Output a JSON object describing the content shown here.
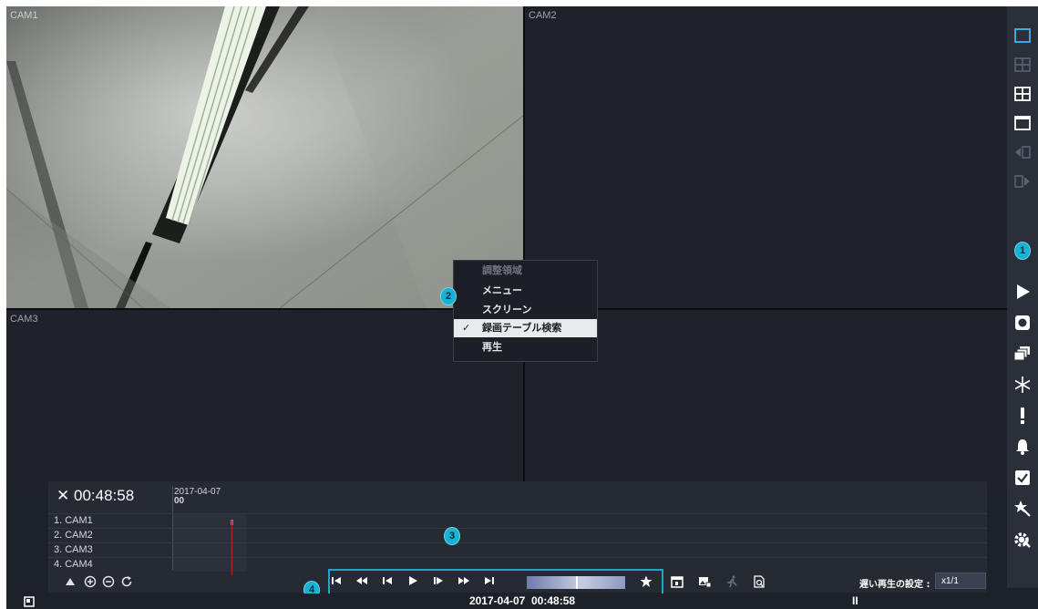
{
  "cameras": [
    {
      "label": "CAM1"
    },
    {
      "label": "CAM2"
    },
    {
      "label": "CAM3"
    }
  ],
  "context_menu": {
    "title": "調整領域",
    "items": [
      {
        "label": "メニュー",
        "checked": false
      },
      {
        "label": "スクリーン",
        "checked": false
      },
      {
        "label": "録画テーブル検索",
        "checked": true
      },
      {
        "label": "再生",
        "checked": false
      }
    ],
    "check_glyph": "✓"
  },
  "badges": [
    "1",
    "2",
    "3",
    "4"
  ],
  "timeline": {
    "current_time": "00:48:58",
    "date": "2017-04-07",
    "hour": "00",
    "channels": [
      "1. CAM1",
      "2. CAM2",
      "3. CAM3",
      "4. CAM4"
    ]
  },
  "playback": {
    "speed_label": "遅い再生の設定 :",
    "speed_value": "x1/1"
  },
  "status_bar": {
    "datetime": "2017-04-07  00:48:58",
    "pause_glyph": "II"
  },
  "sidebar_icons": [
    "single-view-icon",
    "quad-view-grey-icon",
    "quad-view-icon",
    "full-view-icon",
    "prev-icon",
    "next-icon",
    "play-icon",
    "record-icon",
    "sequence-icon",
    "freeze-icon",
    "alarm-icon",
    "bell-icon",
    "check-icon",
    "wizard-icon",
    "settings-icon"
  ],
  "colors": {
    "accent": "#1fa6c8",
    "badge": "#17b2d4",
    "background": "#1d2129",
    "playhead": "#b3262b"
  }
}
